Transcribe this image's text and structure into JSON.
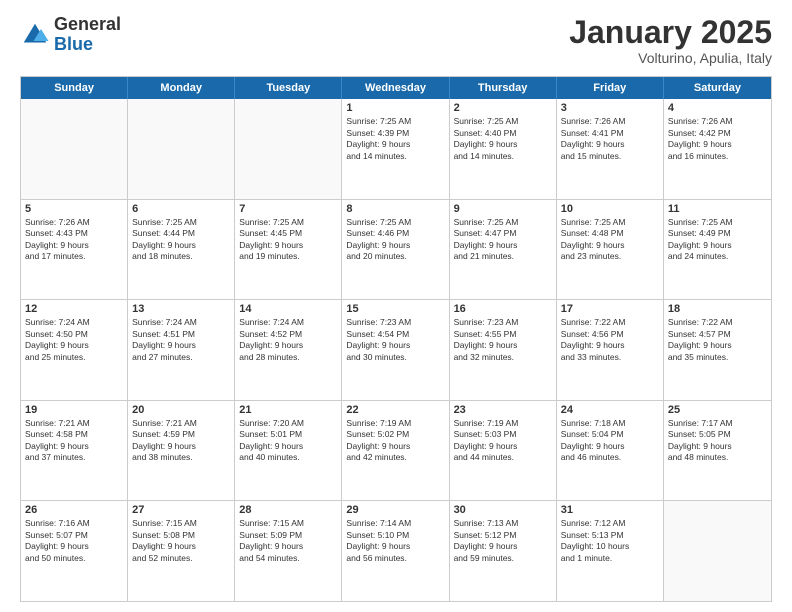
{
  "header": {
    "logo_general": "General",
    "logo_blue": "Blue",
    "month_title": "January 2025",
    "subtitle": "Volturino, Apulia, Italy"
  },
  "weekdays": [
    "Sunday",
    "Monday",
    "Tuesday",
    "Wednesday",
    "Thursday",
    "Friday",
    "Saturday"
  ],
  "rows": [
    [
      {
        "day": "",
        "text": ""
      },
      {
        "day": "",
        "text": ""
      },
      {
        "day": "",
        "text": ""
      },
      {
        "day": "1",
        "text": "Sunrise: 7:25 AM\nSunset: 4:39 PM\nDaylight: 9 hours\nand 14 minutes."
      },
      {
        "day": "2",
        "text": "Sunrise: 7:25 AM\nSunset: 4:40 PM\nDaylight: 9 hours\nand 14 minutes."
      },
      {
        "day": "3",
        "text": "Sunrise: 7:26 AM\nSunset: 4:41 PM\nDaylight: 9 hours\nand 15 minutes."
      },
      {
        "day": "4",
        "text": "Sunrise: 7:26 AM\nSunset: 4:42 PM\nDaylight: 9 hours\nand 16 minutes."
      }
    ],
    [
      {
        "day": "5",
        "text": "Sunrise: 7:26 AM\nSunset: 4:43 PM\nDaylight: 9 hours\nand 17 minutes."
      },
      {
        "day": "6",
        "text": "Sunrise: 7:25 AM\nSunset: 4:44 PM\nDaylight: 9 hours\nand 18 minutes."
      },
      {
        "day": "7",
        "text": "Sunrise: 7:25 AM\nSunset: 4:45 PM\nDaylight: 9 hours\nand 19 minutes."
      },
      {
        "day": "8",
        "text": "Sunrise: 7:25 AM\nSunset: 4:46 PM\nDaylight: 9 hours\nand 20 minutes."
      },
      {
        "day": "9",
        "text": "Sunrise: 7:25 AM\nSunset: 4:47 PM\nDaylight: 9 hours\nand 21 minutes."
      },
      {
        "day": "10",
        "text": "Sunrise: 7:25 AM\nSunset: 4:48 PM\nDaylight: 9 hours\nand 23 minutes."
      },
      {
        "day": "11",
        "text": "Sunrise: 7:25 AM\nSunset: 4:49 PM\nDaylight: 9 hours\nand 24 minutes."
      }
    ],
    [
      {
        "day": "12",
        "text": "Sunrise: 7:24 AM\nSunset: 4:50 PM\nDaylight: 9 hours\nand 25 minutes."
      },
      {
        "day": "13",
        "text": "Sunrise: 7:24 AM\nSunset: 4:51 PM\nDaylight: 9 hours\nand 27 minutes."
      },
      {
        "day": "14",
        "text": "Sunrise: 7:24 AM\nSunset: 4:52 PM\nDaylight: 9 hours\nand 28 minutes."
      },
      {
        "day": "15",
        "text": "Sunrise: 7:23 AM\nSunset: 4:54 PM\nDaylight: 9 hours\nand 30 minutes."
      },
      {
        "day": "16",
        "text": "Sunrise: 7:23 AM\nSunset: 4:55 PM\nDaylight: 9 hours\nand 32 minutes."
      },
      {
        "day": "17",
        "text": "Sunrise: 7:22 AM\nSunset: 4:56 PM\nDaylight: 9 hours\nand 33 minutes."
      },
      {
        "day": "18",
        "text": "Sunrise: 7:22 AM\nSunset: 4:57 PM\nDaylight: 9 hours\nand 35 minutes."
      }
    ],
    [
      {
        "day": "19",
        "text": "Sunrise: 7:21 AM\nSunset: 4:58 PM\nDaylight: 9 hours\nand 37 minutes."
      },
      {
        "day": "20",
        "text": "Sunrise: 7:21 AM\nSunset: 4:59 PM\nDaylight: 9 hours\nand 38 minutes."
      },
      {
        "day": "21",
        "text": "Sunrise: 7:20 AM\nSunset: 5:01 PM\nDaylight: 9 hours\nand 40 minutes."
      },
      {
        "day": "22",
        "text": "Sunrise: 7:19 AM\nSunset: 5:02 PM\nDaylight: 9 hours\nand 42 minutes."
      },
      {
        "day": "23",
        "text": "Sunrise: 7:19 AM\nSunset: 5:03 PM\nDaylight: 9 hours\nand 44 minutes."
      },
      {
        "day": "24",
        "text": "Sunrise: 7:18 AM\nSunset: 5:04 PM\nDaylight: 9 hours\nand 46 minutes."
      },
      {
        "day": "25",
        "text": "Sunrise: 7:17 AM\nSunset: 5:05 PM\nDaylight: 9 hours\nand 48 minutes."
      }
    ],
    [
      {
        "day": "26",
        "text": "Sunrise: 7:16 AM\nSunset: 5:07 PM\nDaylight: 9 hours\nand 50 minutes."
      },
      {
        "day": "27",
        "text": "Sunrise: 7:15 AM\nSunset: 5:08 PM\nDaylight: 9 hours\nand 52 minutes."
      },
      {
        "day": "28",
        "text": "Sunrise: 7:15 AM\nSunset: 5:09 PM\nDaylight: 9 hours\nand 54 minutes."
      },
      {
        "day": "29",
        "text": "Sunrise: 7:14 AM\nSunset: 5:10 PM\nDaylight: 9 hours\nand 56 minutes."
      },
      {
        "day": "30",
        "text": "Sunrise: 7:13 AM\nSunset: 5:12 PM\nDaylight: 9 hours\nand 59 minutes."
      },
      {
        "day": "31",
        "text": "Sunrise: 7:12 AM\nSunset: 5:13 PM\nDaylight: 10 hours\nand 1 minute."
      },
      {
        "day": "",
        "text": ""
      }
    ]
  ]
}
